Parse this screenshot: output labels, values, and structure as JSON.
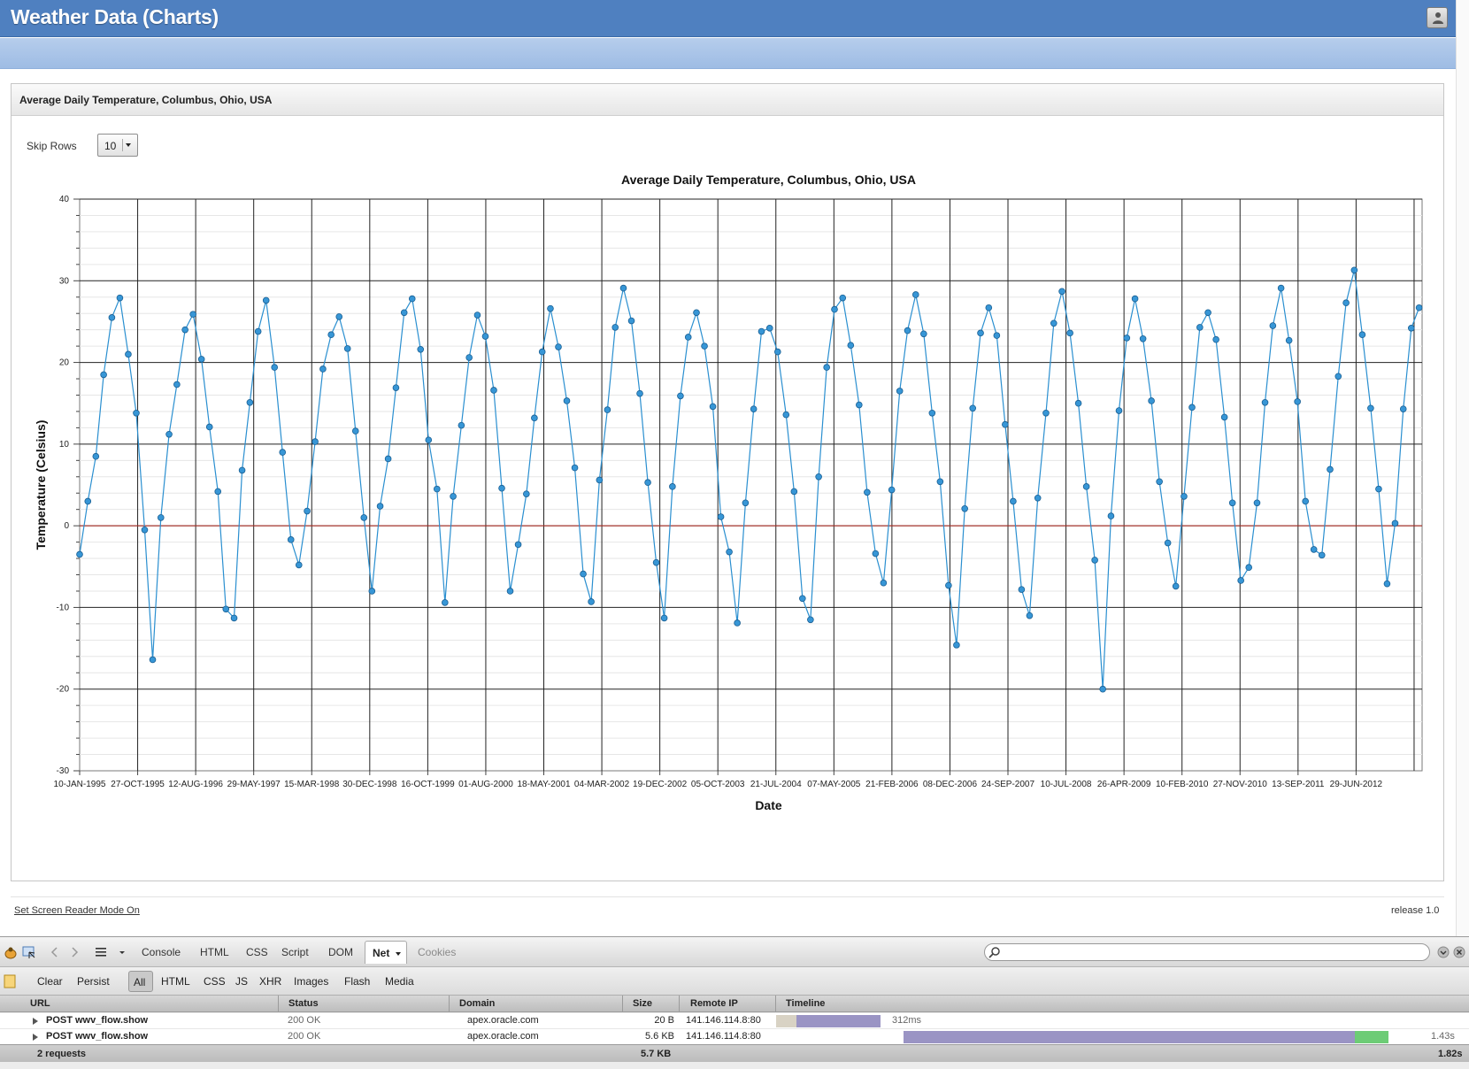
{
  "app": {
    "title": "Weather Data (Charts)"
  },
  "region": {
    "title": "Average Daily Temperature, Columbus, Ohio, USA"
  },
  "controls": {
    "skip_rows_label": "Skip Rows",
    "skip_rows_value": "10"
  },
  "footer": {
    "screen_reader_link": "Set Screen Reader Mode On",
    "release": "release 1.0"
  },
  "chart_data": {
    "type": "line",
    "title": "Average Daily Temperature, Columbus, Ohio, USA",
    "xlabel": "Date",
    "ylabel": "Temperature (Celsius)",
    "ylim": [
      -30,
      40
    ],
    "yticks": [
      -30,
      -20,
      -10,
      0,
      10,
      20,
      30,
      40
    ],
    "xlim": [
      "1995-01-10",
      "2013-05-25"
    ],
    "xtick_labels": [
      "10-JAN-1995",
      "27-OCT-1995",
      "12-AUG-1996",
      "29-MAY-1997",
      "15-MAR-1998",
      "30-DEC-1998",
      "16-OCT-1999",
      "01-AUG-2000",
      "18-MAY-2001",
      "04-MAR-2002",
      "19-DEC-2002",
      "05-OCT-2003",
      "21-JUL-2004",
      "07-MAY-2005",
      "21-FEB-2006",
      "08-DEC-2006",
      "24-SEP-2007",
      "10-JUL-2008",
      "26-APR-2009",
      "10-FEB-2010",
      "27-NOV-2010",
      "13-SEP-2011",
      "29-JUN-2012"
    ],
    "grid": true,
    "legend": "none",
    "series_color": "#2a8fd0",
    "x": [
      "1995-01-10",
      "1995-02-20",
      "1995-04-01",
      "1995-05-10",
      "1995-06-20",
      "1995-07-30",
      "1995-09-10",
      "1995-10-20",
      "1995-12-01",
      "1996-01-10",
      "1996-02-20",
      "1996-04-01",
      "1996-05-10",
      "1996-06-20",
      "1996-07-30",
      "1996-09-10",
      "1996-10-20",
      "1996-12-01",
      "1997-01-10",
      "1997-02-20",
      "1997-04-01",
      "1997-05-10",
      "1997-06-20",
      "1997-07-30",
      "1997-09-10",
      "1997-10-20",
      "1997-12-01",
      "1998-01-10",
      "1998-02-20",
      "1998-04-01",
      "1998-05-10",
      "1998-06-20",
      "1998-07-30",
      "1998-09-10",
      "1998-10-20",
      "1998-12-01",
      "1999-01-10",
      "1999-02-20",
      "1999-04-01",
      "1999-05-10",
      "1999-06-20",
      "1999-07-30",
      "1999-09-10",
      "1999-10-20",
      "1999-12-01",
      "2000-01-10",
      "2000-02-20",
      "2000-04-01",
      "2000-05-10",
      "2000-06-20",
      "2000-07-30",
      "2000-09-10",
      "2000-10-20",
      "2000-12-01",
      "2001-01-10",
      "2001-02-20",
      "2001-04-01",
      "2001-05-10",
      "2001-06-20",
      "2001-07-30",
      "2001-09-10",
      "2001-10-20",
      "2001-12-01",
      "2002-01-10",
      "2002-02-20",
      "2002-04-01",
      "2002-05-10",
      "2002-06-20",
      "2002-07-30",
      "2002-09-10",
      "2002-10-20",
      "2002-12-01",
      "2003-01-10",
      "2003-02-20",
      "2003-04-01",
      "2003-05-10",
      "2003-06-20",
      "2003-07-30",
      "2003-09-10",
      "2003-10-20",
      "2003-12-01",
      "2004-01-10",
      "2004-02-20",
      "2004-04-01",
      "2004-05-10",
      "2004-06-20",
      "2004-07-30",
      "2004-09-10",
      "2004-10-20",
      "2004-12-01",
      "2005-01-10",
      "2005-02-20",
      "2005-04-01",
      "2005-05-10",
      "2005-06-20",
      "2005-07-30",
      "2005-09-10",
      "2005-10-20",
      "2005-12-01",
      "2006-01-10",
      "2006-02-20",
      "2006-04-01",
      "2006-05-10",
      "2006-06-20",
      "2006-07-30",
      "2006-09-10",
      "2006-10-20",
      "2006-12-01",
      "2007-01-10",
      "2007-02-20",
      "2007-04-01",
      "2007-05-10",
      "2007-06-20",
      "2007-07-30",
      "2007-09-10",
      "2007-10-20",
      "2007-12-01",
      "2008-01-10",
      "2008-02-20",
      "2008-04-01",
      "2008-05-10",
      "2008-06-20",
      "2008-07-30",
      "2008-09-10",
      "2008-10-20",
      "2008-12-01",
      "2009-01-10",
      "2009-02-20",
      "2009-04-01",
      "2009-05-10",
      "2009-06-20",
      "2009-07-30",
      "2009-09-10",
      "2009-10-20",
      "2009-12-01",
      "2010-01-10",
      "2010-02-20",
      "2010-04-01",
      "2010-05-10",
      "2010-06-20",
      "2010-07-30",
      "2010-09-10",
      "2010-10-20",
      "2010-12-01",
      "2011-01-10",
      "2011-02-20",
      "2011-04-01",
      "2011-05-10",
      "2011-06-20",
      "2011-07-30",
      "2011-09-10",
      "2011-10-20",
      "2011-12-01",
      "2012-01-10",
      "2012-02-20",
      "2012-04-01",
      "2012-05-10",
      "2012-06-20",
      "2012-07-30",
      "2012-09-10",
      "2012-10-20",
      "2012-12-01",
      "2013-01-10",
      "2013-02-20",
      "2013-04-01",
      "2013-05-10"
    ],
    "y": [
      -3.5,
      3,
      8.5,
      18.5,
      25.5,
      27.9,
      21,
      13.8,
      -0.5,
      -16.4,
      1,
      11.2,
      17.3,
      24,
      25.9,
      20.4,
      12.1,
      4.2,
      -10.2,
      -11.3,
      6.8,
      15.1,
      23.8,
      27.6,
      19.4,
      9,
      -1.7,
      -4.8,
      1.8,
      10.3,
      19.2,
      23.4,
      25.6,
      21.7,
      11.6,
      1,
      -8,
      2.4,
      8.2,
      16.9,
      26.1,
      27.8,
      21.6,
      10.5,
      4.5,
      -9.4,
      3.6,
      12.3,
      20.6,
      25.8,
      23.2,
      16.6,
      4.6,
      -8,
      -2.3,
      3.9,
      13.2,
      21.3,
      26.6,
      21.9,
      15.3,
      7.1,
      -5.9,
      -9.3,
      5.6,
      14.2,
      24.3,
      29.1,
      25.1,
      16.2,
      5.3,
      -4.5,
      -11.3,
      4.8,
      15.9,
      23.1,
      26.1,
      22,
      14.6,
      1.1,
      -3.2,
      -11.9,
      2.8,
      14.3,
      23.8,
      24.2,
      21.3,
      13.6,
      4.2,
      -8.9,
      -11.5,
      6,
      19.4,
      26.5,
      27.9,
      22.1,
      14.8,
      4.1,
      -3.4,
      -7,
      4.4,
      16.5,
      23.9,
      28.3,
      23.5,
      13.8,
      5.4,
      -7.3,
      -14.6,
      2.1,
      14.4,
      23.6,
      26.7,
      23.3,
      12.4,
      3,
      -7.8,
      -11,
      3.4,
      13.8,
      24.8,
      28.7,
      23.6,
      15,
      4.8,
      -4.2,
      -20,
      1.2,
      14.1,
      23,
      27.8,
      22.9,
      15.3,
      5.4,
      -2.1,
      -7.4,
      3.6,
      14.5,
      24.3,
      26.1,
      22.8,
      13.3,
      2.8,
      -6.7,
      -5.1,
      2.8,
      15.1,
      24.5,
      29.1,
      22.7,
      15.2,
      3,
      -2.9,
      -3.6,
      6.9,
      18.3,
      27.3,
      31.3,
      23.4,
      14.4,
      4.5,
      -7.1,
      0.3,
      14.3,
      24.2,
      26.7
    ]
  },
  "firebug": {
    "tabs": [
      "Console",
      "HTML",
      "CSS",
      "Script",
      "DOM",
      "Net",
      "Cookies"
    ],
    "net_buttons": [
      "Clear",
      "Persist",
      "All",
      "HTML",
      "CSS",
      "JS",
      "XHR",
      "Images",
      "Flash",
      "Media"
    ],
    "columns": [
      "URL",
      "Status",
      "Domain",
      "Size",
      "Remote IP",
      "Timeline"
    ],
    "requests": [
      {
        "url": "POST wwv_flow.show",
        "status": "200 OK",
        "domain": "apex.oracle.com",
        "size": "20 B",
        "remote_ip": "141.146.114.8:80",
        "time": "312ms",
        "wait": 0.2,
        "receive": 0.8
      },
      {
        "url": "POST wwv_flow.show",
        "status": "200 OK",
        "domain": "apex.oracle.com",
        "size": "5.6 KB",
        "remote_ip": "141.146.114.8:80",
        "time": "1.43s",
        "wait": 0.83,
        "receive": 0.05
      }
    ],
    "summary": {
      "count": "2 requests",
      "size": "5.7 KB",
      "total": "1.82s"
    },
    "colors": {
      "wait": "#9a94c4",
      "receive": "#6dcc76",
      "blocked": "#d8d2c4"
    }
  }
}
